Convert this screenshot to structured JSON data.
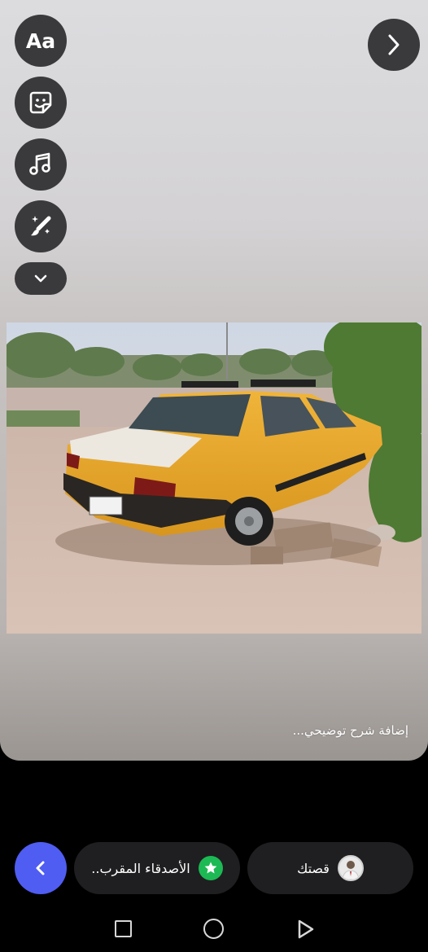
{
  "toolbar": {
    "text_label": "Aa",
    "icons": [
      "text-icon",
      "sticker-icon",
      "music-icon",
      "effects-icon",
      "chevron-down-icon"
    ]
  },
  "next_icon": "chevron-right-icon",
  "caption": {
    "placeholder": "إضافة شرح توضيحي..."
  },
  "share": {
    "close_friends_label": "الأصدقاء المقرب..",
    "your_story_label": "قصتك",
    "accent_color": "#4f5df2",
    "close_friends_color": "#1db954"
  },
  "system_nav": [
    "recents-icon",
    "home-icon",
    "back-icon"
  ]
}
